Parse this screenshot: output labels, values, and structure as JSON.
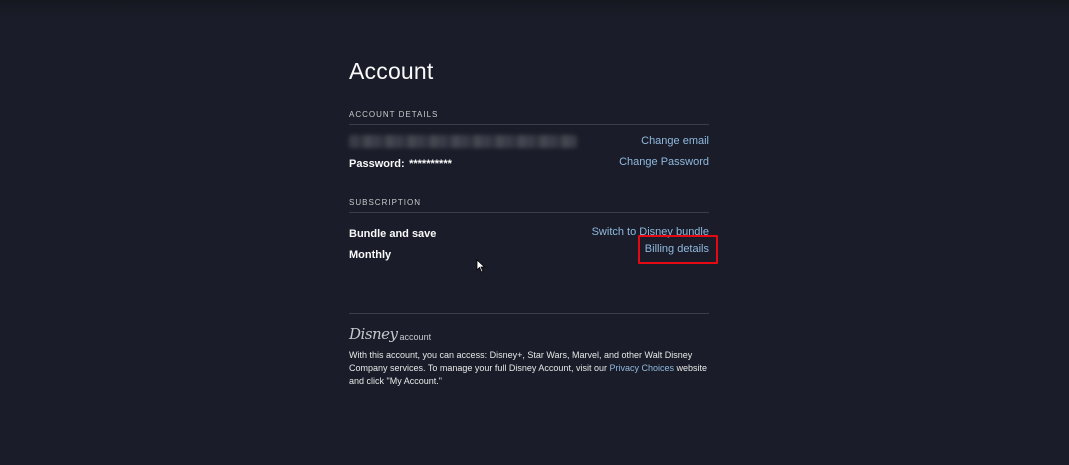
{
  "page": {
    "title": "Account"
  },
  "account_details": {
    "header": "ACCOUNT DETAILS",
    "change_email_label": "Change email",
    "password_label": "Password:",
    "password_mask": "**********",
    "change_password_label": "Change Password"
  },
  "subscription": {
    "header": "SUBSCRIPTION",
    "plan_name": "Bundle and save",
    "switch_label": "Switch to Disney bundle",
    "billing_cycle": "Monthly",
    "billing_details_label": "Billing details"
  },
  "footer": {
    "logo_disney": "Disney",
    "logo_account": "account",
    "text_before_link": "With this account, you can access: Disney+, Star Wars, Marvel, and other Walt Disney Company services. To manage your full Disney Account, visit our ",
    "privacy_link": "Privacy Choices",
    "text_after_link": " website and click \"My Account.\""
  },
  "colors": {
    "background": "#1a1d29",
    "link": "#8fb9de",
    "highlight": "#e50914"
  }
}
